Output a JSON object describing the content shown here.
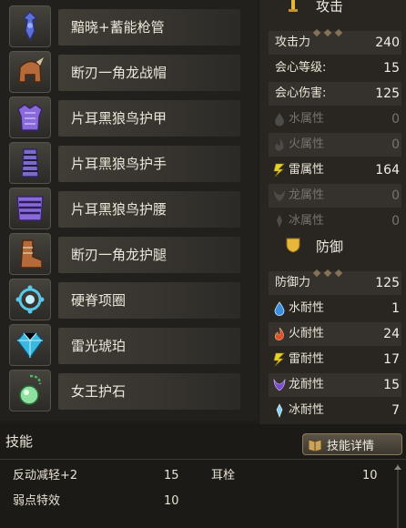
{
  "equipment": [
    {
      "name": "黯晓+蓄能枪管",
      "icon": "gun-barrel-icon",
      "color": "#5a6fd8"
    },
    {
      "name": "断刃一角龙战帽",
      "icon": "helmet-icon",
      "color": "#b56a3a"
    },
    {
      "name": "片耳黑狼鸟护甲",
      "icon": "chest-armor-icon",
      "color": "#8a6ad8"
    },
    {
      "name": "片耳黑狼鸟护手",
      "icon": "gauntlet-icon",
      "color": "#7c6cc8"
    },
    {
      "name": "片耳黑狼鸟护腰",
      "icon": "waist-armor-icon",
      "color": "#8a6ad8"
    },
    {
      "name": "断刃一角龙护腿",
      "icon": "leg-armor-icon",
      "color": "#b56a3a"
    },
    {
      "name": "硬脊项圈",
      "icon": "charm-ring-icon",
      "color": "#5ac8e8"
    },
    {
      "name": "雷光琥珀",
      "icon": "gem-icon",
      "color": "#3ab8e0"
    },
    {
      "name": "女王护石",
      "icon": "talisman-icon",
      "color": "#4ab868"
    }
  ],
  "attack": {
    "title": "攻击",
    "rows": [
      {
        "label": "攻击力",
        "value": "240"
      },
      {
        "label": "会心等级:",
        "value": "15"
      },
      {
        "label": "会心伤害:",
        "value": "125"
      },
      {
        "label": "水属性",
        "value": "0",
        "icon": "water-drop-icon"
      },
      {
        "label": "火属性",
        "value": "0",
        "icon": "fire-icon"
      },
      {
        "label": "雷属性",
        "value": "164",
        "icon": "thunder-icon"
      },
      {
        "label": "龙属性",
        "value": "0",
        "icon": "dragon-icon"
      },
      {
        "label": "冰属性",
        "value": "0",
        "icon": "ice-icon"
      }
    ]
  },
  "defense": {
    "title": "防御",
    "rows": [
      {
        "label": "防御力",
        "value": "125"
      },
      {
        "label": "水耐性",
        "value": "1",
        "icon": "water-drop-icon"
      },
      {
        "label": "火耐性",
        "value": "24",
        "icon": "fire-icon"
      },
      {
        "label": "雷耐性",
        "value": "17",
        "icon": "thunder-icon"
      },
      {
        "label": "龙耐性",
        "value": "15",
        "icon": "dragon-icon"
      },
      {
        "label": "冰耐性",
        "value": "7",
        "icon": "ice-icon"
      }
    ]
  },
  "skills": {
    "title": "技能",
    "details_button": "技能详情",
    "list": [
      {
        "name": "反动减轻+2",
        "value": "15"
      },
      {
        "name": "耳栓",
        "value": "10"
      },
      {
        "name": "弱点特效",
        "value": "10"
      }
    ]
  },
  "colors": {
    "water": "#3a8ee0",
    "fire": "#e0502a",
    "thunder": "#e8d22a",
    "dragon": "#7a4ad0",
    "ice": "#8ad0f0",
    "shield": "#e8b63a"
  }
}
